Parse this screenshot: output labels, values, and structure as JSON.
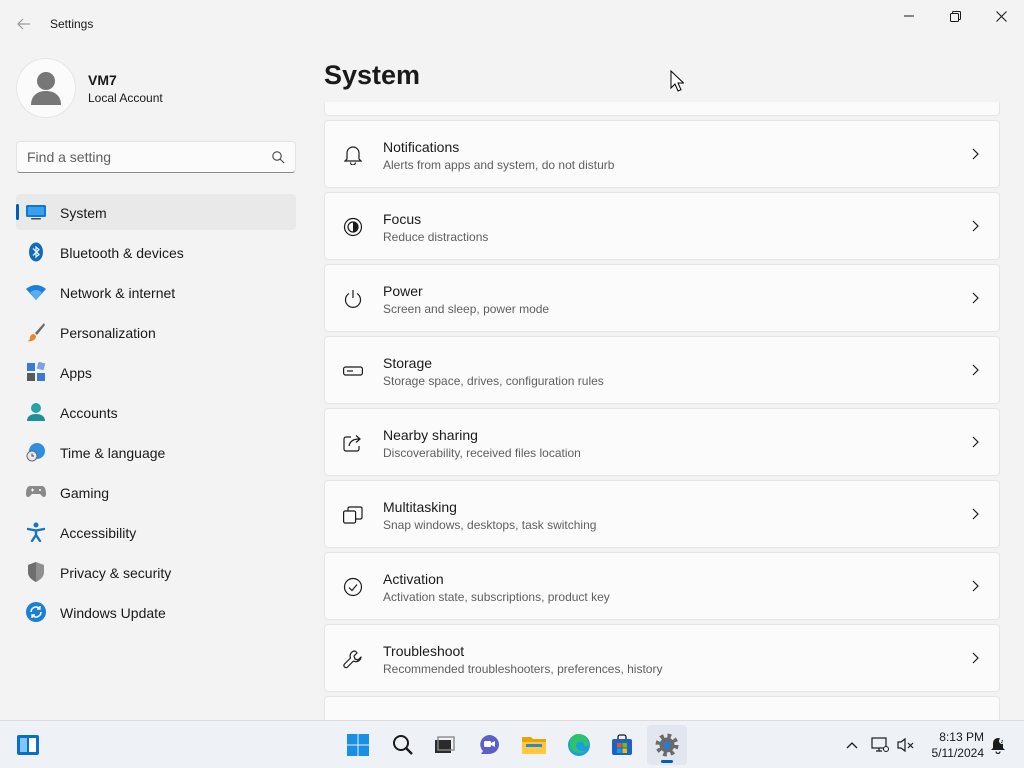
{
  "window": {
    "title": "Settings",
    "controls": {
      "minimize": "minimize",
      "maximize": "maximize",
      "close": "close"
    }
  },
  "profile": {
    "name": "VM7",
    "account_type": "Local Account"
  },
  "search": {
    "placeholder": "Find a setting",
    "value": ""
  },
  "sidebar": {
    "items": [
      {
        "label": "System",
        "icon": "system-display-icon",
        "active": true
      },
      {
        "label": "Bluetooth & devices",
        "icon": "bluetooth-icon"
      },
      {
        "label": "Network & internet",
        "icon": "wifi-icon"
      },
      {
        "label": "Personalization",
        "icon": "paintbrush-icon"
      },
      {
        "label": "Apps",
        "icon": "apps-icon"
      },
      {
        "label": "Accounts",
        "icon": "accounts-icon"
      },
      {
        "label": "Time & language",
        "icon": "globe-clock-icon"
      },
      {
        "label": "Gaming",
        "icon": "gamepad-icon"
      },
      {
        "label": "Accessibility",
        "icon": "accessibility-icon"
      },
      {
        "label": "Privacy & security",
        "icon": "shield-icon"
      },
      {
        "label": "Windows Update",
        "icon": "update-icon"
      }
    ]
  },
  "main": {
    "title": "System",
    "cards": [
      {
        "title": "Notifications",
        "subtitle": "Alerts from apps and system, do not disturb",
        "icon": "bell-icon"
      },
      {
        "title": "Focus",
        "subtitle": "Reduce distractions",
        "icon": "focus-icon"
      },
      {
        "title": "Power",
        "subtitle": "Screen and sleep, power mode",
        "icon": "power-icon"
      },
      {
        "title": "Storage",
        "subtitle": "Storage space, drives, configuration rules",
        "icon": "storage-icon"
      },
      {
        "title": "Nearby sharing",
        "subtitle": "Discoverability, received files location",
        "icon": "share-icon"
      },
      {
        "title": "Multitasking",
        "subtitle": "Snap windows, desktops, task switching",
        "icon": "multitasking-icon"
      },
      {
        "title": "Activation",
        "subtitle": "Activation state, subscriptions, product key",
        "icon": "check-circle-icon"
      },
      {
        "title": "Troubleshoot",
        "subtitle": "Recommended troubleshooters, preferences, history",
        "icon": "wrench-icon"
      }
    ]
  },
  "taskbar": {
    "apps": [
      "widgets-icon",
      "start-icon",
      "search-icon",
      "task-view-icon",
      "chat-icon",
      "file-explorer-icon",
      "edge-icon",
      "store-icon",
      "settings-icon"
    ],
    "clock": {
      "time": "8:13 PM",
      "date": "5/11/2024"
    }
  },
  "colors": {
    "accent": "#005fb8",
    "background": "#f3f3f3",
    "card": "#fbfbfb"
  }
}
